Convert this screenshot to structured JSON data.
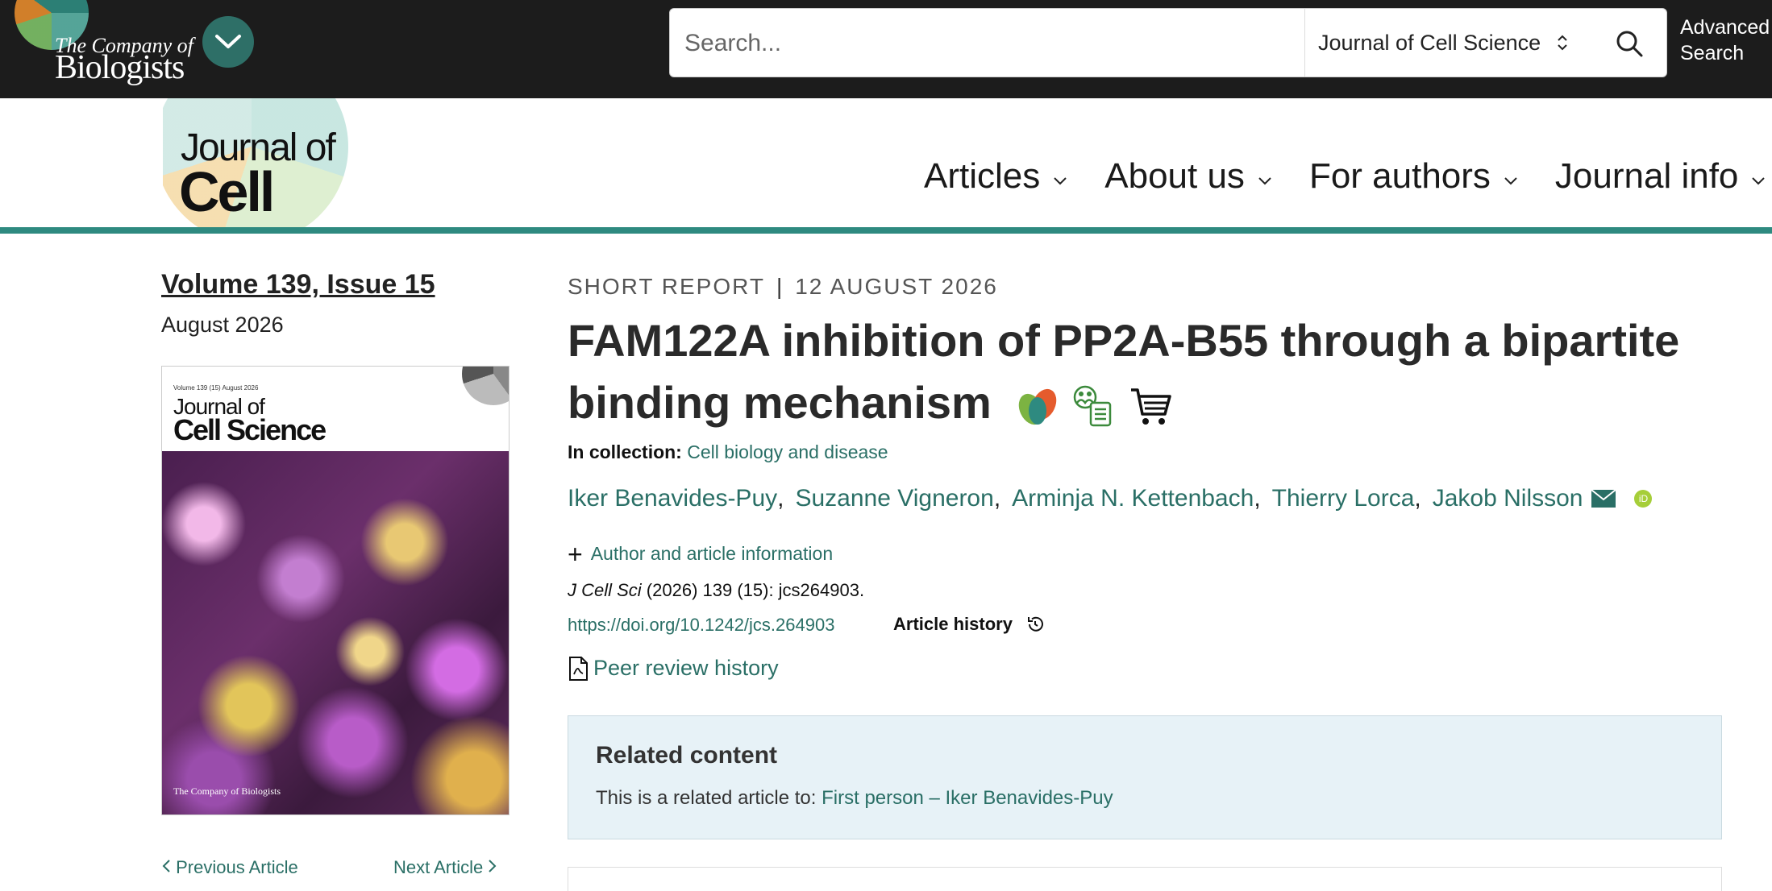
{
  "brand": {
    "publisher_line1": "The Company of",
    "publisher_line2": "Biologists"
  },
  "search": {
    "placeholder": "Search...",
    "scope": "Journal of Cell Science",
    "advanced_line1": "Advanced",
    "advanced_line2": "Search"
  },
  "journal": {
    "logo_line1": "Journal of",
    "logo_line2": "Cell Science"
  },
  "nav": {
    "items": [
      {
        "label": "Articles"
      },
      {
        "label": "About us"
      },
      {
        "label": "For authors"
      },
      {
        "label": "Journal info"
      }
    ]
  },
  "issue": {
    "title": "Volume 139, Issue 15",
    "date": "August 2026",
    "cover_volume": "Volume 139 (15) August 2026",
    "cover_journal_line1": "Journal of",
    "cover_journal_line2": "Cell Science",
    "cover_publisher": "The Company of Biologists"
  },
  "article_nav": {
    "prev": "Previous Article",
    "next": "Next Article"
  },
  "article": {
    "type": "SHORT REPORT",
    "date": "12 AUGUST 2026",
    "title": "FAM122A inhibition of PP2A-B55 through a bipartite binding mechanism",
    "collection_label": "In collection:",
    "collection_link": "Cell biology and disease",
    "authors": [
      "Iker Benavides-Puy",
      "Suzanne Vigneron",
      "Arminja N. Kettenbach",
      "Thierry Lorca",
      "Jakob Nilsson"
    ],
    "author_info": "Author and article information",
    "citation_journal": "J Cell Sci",
    "citation_rest": " (2026) 139 (15): jcs264903.",
    "doi": "https://doi.org/10.1242/jcs.264903",
    "history_label": "Article history",
    "peer_review": "Peer review history"
  },
  "related": {
    "heading": "Related content",
    "text": "This is a related article to: ",
    "link": "First person – Iker Benavides-Puy"
  },
  "icons": {
    "menu": "chevron-down-icon",
    "search": "search-icon",
    "open_access": "leaf-icon",
    "people_doc": "people-document-icon",
    "cart": "cart-icon",
    "mail": "envelope-icon",
    "orcid": "orcid-icon",
    "plus": "plus-icon",
    "history": "history-icon",
    "pdf": "pdf-icon"
  },
  "colors": {
    "topbar": "#1c1c1c",
    "teal_accent": "#2e8a80",
    "link": "#2a6f66",
    "related_bg": "#e7f2f7"
  }
}
